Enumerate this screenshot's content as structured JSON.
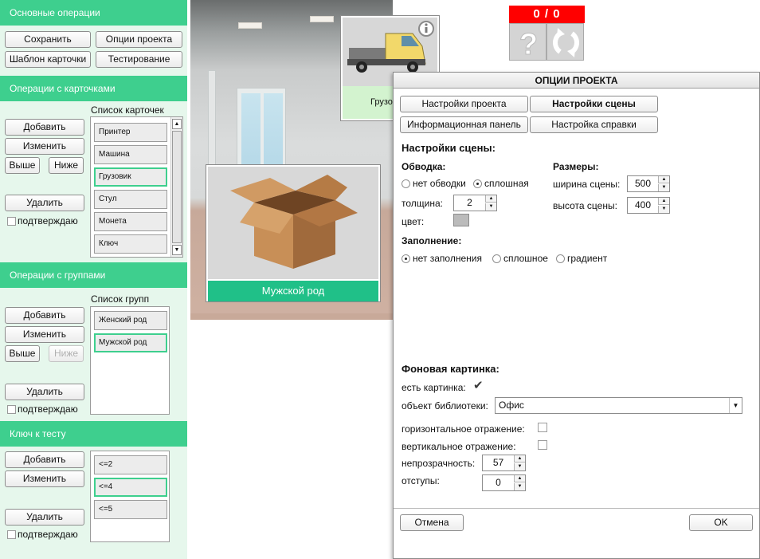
{
  "left": {
    "basic": {
      "header": "Основные операции",
      "save": "Сохранить",
      "project_options": "Опции проекта",
      "card_template": "Шаблон карточки",
      "testing": "Тестирование"
    },
    "cards": {
      "header": "Операции с карточками",
      "list_title": "Список карточек",
      "add": "Добавить",
      "edit": "Изменить",
      "up": "Выше",
      "down": "Ниже",
      "delete": "Удалить",
      "confirm": "подтверждаю",
      "items": [
        "Принтер",
        "Машина",
        "Грузовик",
        "Стул",
        "Монета",
        "Ключ"
      ]
    },
    "groups": {
      "header": "Операции с группами",
      "list_title": "Список групп",
      "add": "Добавить",
      "edit": "Изменить",
      "up": "Выше",
      "down": "Ниже",
      "delete": "Удалить",
      "confirm": "подтверждаю",
      "items": [
        "Женский род",
        "Мужской род"
      ]
    },
    "key": {
      "header": "Ключ к тесту",
      "add": "Добавить",
      "edit": "Изменить",
      "delete": "Удалить",
      "confirm": "подтверждаю",
      "items": [
        "<=2",
        "<=4",
        "<=5"
      ]
    }
  },
  "scene": {
    "score": "0 / 0",
    "card_caption": "Мужской род",
    "preview_label": "Грузовик"
  },
  "dialog": {
    "title": "ОПЦИИ ПРОЕКТА",
    "tabs": [
      "Настройки проекта",
      "Настройки сцены",
      "Информационная панель",
      "Настройка справки"
    ],
    "section_title": "Настройки сцены:",
    "stroke": {
      "title": "Обводка:",
      "no_stroke": "нет обводки",
      "solid": "сплошная",
      "thickness_label": "толщина:",
      "thickness": "2",
      "color_label": "цвет:"
    },
    "size": {
      "title": "Размеры:",
      "width_label": "ширина сцены:",
      "width": "500",
      "height_label": "высота сцены:",
      "height": "400"
    },
    "fill": {
      "title": "Заполнение:",
      "none": "нет заполнения",
      "solid": "сплошное",
      "gradient": "градиент"
    },
    "background": {
      "title": "Фоновая картинка:",
      "has_image_label": "есть картинка:",
      "library_label": "объект библиотеки:",
      "library_value": "Офис",
      "hflip_label": "горизонтальное отражение:",
      "vflip_label": "вертикальное отражение:",
      "opacity_label": "непрозрачность:",
      "opacity": "57",
      "padding_label": "отступы:",
      "padding": "0"
    },
    "cancel": "Отмена",
    "ok": "OK"
  },
  "colors": {
    "accent": "#3ecf8e",
    "panel_bg": "#e6f7ec",
    "score_bg": "#ff0000"
  }
}
